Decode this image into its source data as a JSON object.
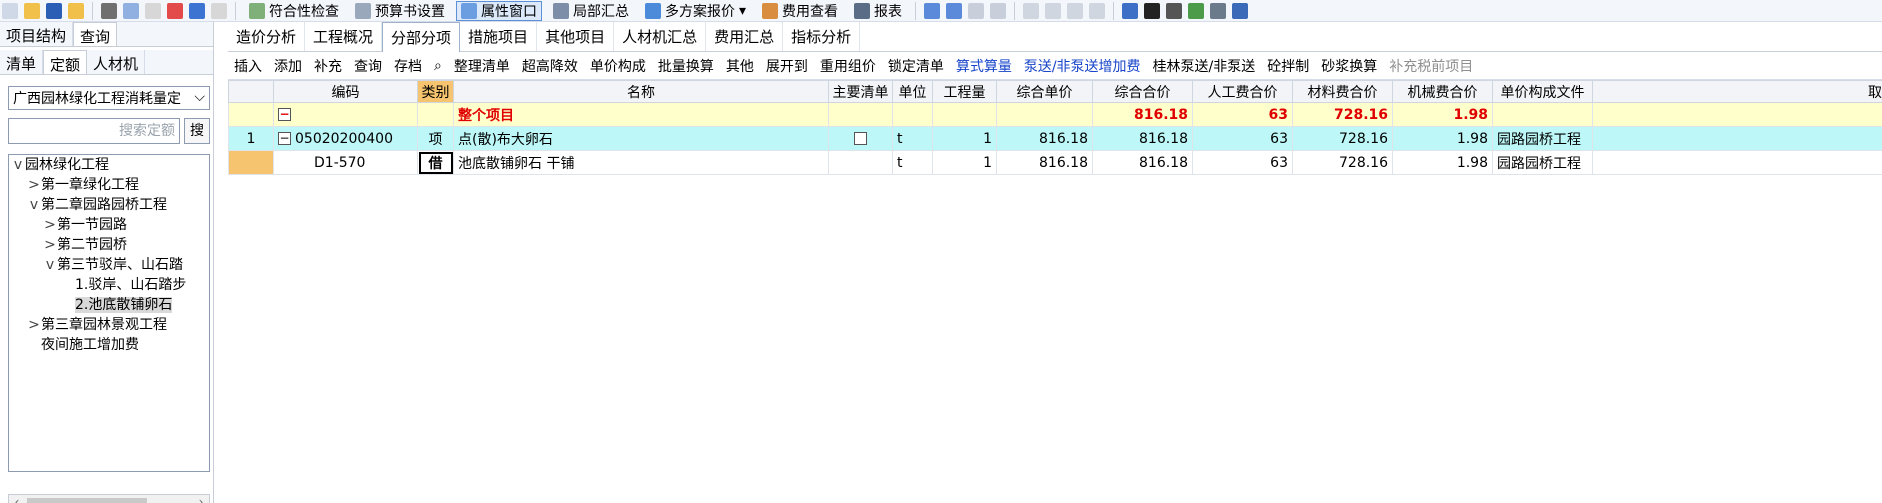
{
  "toolbar": {
    "items": [
      {
        "label": "符合性检查",
        "icon": "check-icon"
      },
      {
        "label": "预算书设置",
        "icon": "gear-icon"
      },
      {
        "label": "属性窗口",
        "icon": "window-icon"
      },
      {
        "label": "局部汇总",
        "icon": "sum-icon"
      },
      {
        "label": "多方案报价",
        "icon": "multi-icon"
      },
      {
        "label": "费用查看",
        "icon": "cost-icon"
      },
      {
        "label": "报表",
        "icon": "report-icon"
      }
    ]
  },
  "left": {
    "tabs_top": [
      "项目结构",
      "查询"
    ],
    "tabs_bottom": [
      "清单",
      "定额",
      "人材机"
    ],
    "library_select": "广西园林绿化工程消耗量定",
    "search_placeholder": "搜索定额",
    "search_button": "搜",
    "tree": [
      {
        "label": "园林绿化工程",
        "level": 0,
        "toggle": "v"
      },
      {
        "label": "第一章绿化工程",
        "level": 1,
        "toggle": ">"
      },
      {
        "label": "第二章园路园桥工程",
        "level": 1,
        "toggle": "v"
      },
      {
        "label": "第一节园路",
        "level": 2,
        "toggle": ">"
      },
      {
        "label": "第二节园桥",
        "level": 2,
        "toggle": ">"
      },
      {
        "label": "第三节驳岸、山石踏",
        "level": 2,
        "toggle": "v"
      },
      {
        "label": "1.驳岸、山石踏步",
        "level": 3,
        "toggle": ""
      },
      {
        "label": "2.池底散铺卵石",
        "level": 3,
        "toggle": "",
        "selected": true
      },
      {
        "label": "第三章园林景观工程",
        "level": 1,
        "toggle": ">"
      },
      {
        "label": "夜间施工增加费",
        "level": 1,
        "toggle": ""
      }
    ]
  },
  "main": {
    "tabs": [
      "造价分析",
      "工程概况",
      "分部分项",
      "措施项目",
      "其他项目",
      "人材机汇总",
      "费用汇总",
      "指标分析"
    ],
    "selected_tab": "分部分项",
    "toolbar2": [
      "插入",
      "添加",
      "补充",
      "查询",
      "存档",
      "整理清单",
      "超高降效",
      "单价构成",
      "批量换算",
      "其他",
      "展开到",
      "重用组价",
      "锁定清单",
      "算式算量",
      "泵送/非泵送增加费",
      "桂林泵送/非泵送",
      "砼拌制",
      "砂浆换算",
      "补充税前项目"
    ],
    "columns": [
      "编码",
      "类别",
      "名称",
      "主要清单",
      "单位",
      "工程量",
      "综合单价",
      "综合合价",
      "人工费合价",
      "材料费合价",
      "机械费合价",
      "单价构成文件",
      "取"
    ],
    "rows": [
      {
        "kind": "project",
        "seq": "",
        "code": "",
        "type": "",
        "name": "整个项目",
        "unit": "",
        "qty": "",
        "unit_price": "",
        "total": "816.18",
        "labor": "63",
        "material": "728.16",
        "machine": "1.98",
        "file": ""
      },
      {
        "kind": "item",
        "seq": "1",
        "code": "05020200400",
        "type": "项",
        "name": "点(散)布大卵石",
        "unit": "t",
        "qty": "1",
        "unit_price": "816.18",
        "total": "816.18",
        "labor": "63",
        "material": "728.16",
        "machine": "1.98",
        "file": "园路园桥工程"
      },
      {
        "kind": "quota",
        "seq": "",
        "code": "D1-570",
        "type": "借",
        "name": "池底散铺卵石 干铺",
        "unit": "t",
        "qty": "1",
        "unit_price": "816.18",
        "total": "816.18",
        "labor": "63",
        "material": "728.16",
        "machine": "1.98",
        "file": "园路园桥工程"
      }
    ]
  }
}
